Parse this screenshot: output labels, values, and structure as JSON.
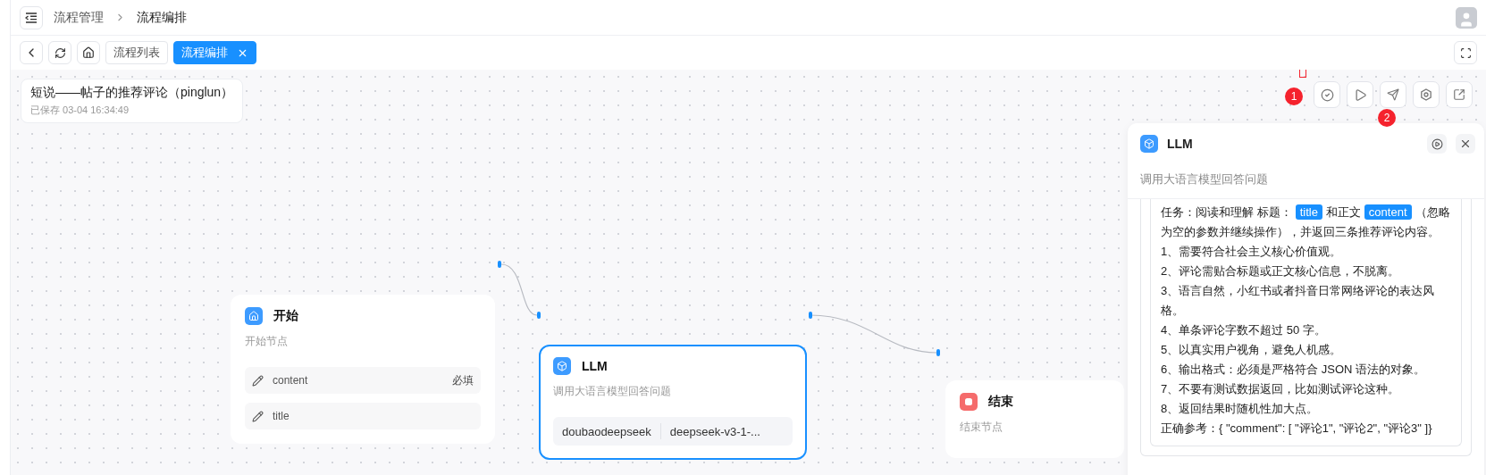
{
  "header": {
    "breadcrumbs": [
      {
        "label": "流程管理"
      },
      {
        "label": "流程编排"
      }
    ]
  },
  "tabs": [
    {
      "label": "流程列表",
      "selected": false
    },
    {
      "label": "流程编排",
      "selected": true
    }
  ],
  "flow": {
    "name": "短说——帖子的推荐评论（pinglun）",
    "saved": "已保存 03-04 16:34:49"
  },
  "badges": [
    "1",
    "2"
  ],
  "nodes": [
    {
      "kind": "start",
      "title": "开始",
      "description": "开始节点",
      "selected": false,
      "params": [
        {
          "name": "content",
          "required": "必填"
        },
        {
          "name": "title"
        }
      ]
    },
    {
      "kind": "llm",
      "title": "LLM",
      "description": "调用大语言模型回答问题",
      "selected": true,
      "provider": "doubaodeepseek",
      "model": "deepseek-v3-1-..."
    },
    {
      "kind": "end",
      "title": "结束",
      "description": "结束节点",
      "selected": false
    }
  ],
  "panel": {
    "title": "LLM",
    "description": "调用大语言模型回答问题",
    "prompt": [
      [
        {
          "kind": "text",
          "text": "任务：阅读和理解 标题："
        },
        {
          "kind": "variable",
          "text": "title"
        },
        {
          "kind": "text",
          "text": "和正文"
        },
        {
          "kind": "variable",
          "text": "content"
        },
        {
          "kind": "text",
          "text": "（忽略为空的参数并继续操作），并返回三条推荐评论内容。"
        }
      ],
      "1、需要符合社会主义核心价值观。",
      "2、评论需贴合标题或正文核心信息，不脱离。",
      "3、语言自然，小红书或者抖音日常网络评论的表达风格。",
      "4、单条评论字数不超过 50 字。",
      "5、以真实用户视角，避免人机感。",
      "6、输出格式：必须是严格符合 JSON 语法的对象。",
      "7、不要有测试数据返回，比如测试评论这种。",
      "8、返回结果时随机性加大点。",
      "正确参考：{ \"comment\": [ \"评论1\", \"评论2\", \"评论3\" ]}"
    ]
  }
}
